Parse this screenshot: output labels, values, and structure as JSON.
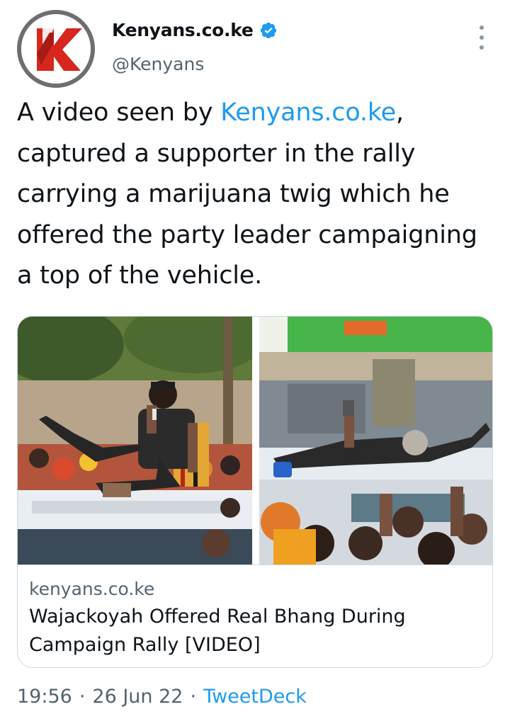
{
  "author": {
    "display_name": "Kenyans.co.ke",
    "handle": "@Kenyans",
    "avatar_icon": "kenyans-k-logo",
    "verified": true,
    "verified_color": "#1d9bf0"
  },
  "tweet": {
    "text_before": "A video seen by ",
    "link_text": "Kenyans.co.ke",
    "text_after": ", captured a supporter in the rally carrying a marijuana twig which he offered the party leader campaigning a top of the vehicle."
  },
  "card": {
    "domain": "kenyans.co.ke",
    "title": "Wajackoyah Offered Real Bhang During Campaign Rally [VIDEO]"
  },
  "meta": {
    "time": "19:56",
    "separator": "·",
    "date": "26 Jun 22",
    "source": "TweetDeck"
  },
  "colors": {
    "link": "#1d9bf0",
    "secondary_text": "#536471",
    "brand_red": "#d7261e"
  }
}
